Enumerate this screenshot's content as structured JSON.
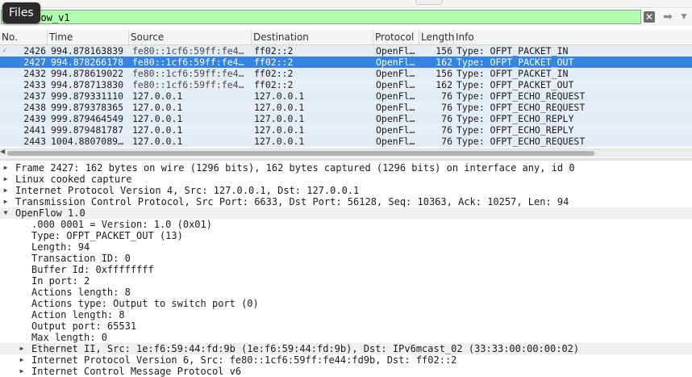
{
  "tooltip": {
    "text": "Files"
  },
  "filter": {
    "value": "flow_v1"
  },
  "columns": [
    "No.",
    "Time",
    "Source",
    "Destination",
    "Protocol",
    "Length",
    "Info"
  ],
  "packets": [
    {
      "no": "2426",
      "time": "994.878163839",
      "src": "fe80::1cf6:59ff:fe4…",
      "dst": "ff02::2",
      "proto": "OpenFl…",
      "len": "156",
      "info": "Type: OFPT_PACKET_IN",
      "selected": false,
      "mark": "✓"
    },
    {
      "no": "2427",
      "time": "994.878266178",
      "src": "fe80::1cf6:59ff:fe4…",
      "dst": "ff02::2",
      "proto": "OpenFl…",
      "len": "162",
      "info": "Type: OFPT_PACKET_OUT",
      "selected": true,
      "mark": ""
    },
    {
      "no": "2432",
      "time": "994.878619022",
      "src": "fe80::1cf6:59ff:fe4…",
      "dst": "ff02::2",
      "proto": "OpenFl…",
      "len": "156",
      "info": "Type: OFPT_PACKET_IN",
      "selected": false,
      "mark": ""
    },
    {
      "no": "2433",
      "time": "994.878713830",
      "src": "fe80::1cf6:59ff:fe4…",
      "dst": "ff02::2",
      "proto": "OpenFl…",
      "len": "162",
      "info": "Type: OFPT_PACKET_OUT",
      "selected": false,
      "mark": ""
    },
    {
      "no": "2437",
      "time": "999.879331110",
      "src": "127.0.0.1",
      "dst": "127.0.0.1",
      "proto": "OpenFl…",
      "len": "76",
      "info": "Type: OFPT_ECHO_REQUEST",
      "selected": false,
      "mark": ""
    },
    {
      "no": "2438",
      "time": "999.879378365",
      "src": "127.0.0.1",
      "dst": "127.0.0.1",
      "proto": "OpenFl…",
      "len": "76",
      "info": "Type: OFPT_ECHO_REQUEST",
      "selected": false,
      "mark": ""
    },
    {
      "no": "2439",
      "time": "999.879464549",
      "src": "127.0.0.1",
      "dst": "127.0.0.1",
      "proto": "OpenFl…",
      "len": "76",
      "info": "Type: OFPT_ECHO_REPLY",
      "selected": false,
      "mark": ""
    },
    {
      "no": "2441",
      "time": "999.879481787",
      "src": "127.0.0.1",
      "dst": "127.0.0.1",
      "proto": "OpenFl…",
      "len": "76",
      "info": "Type: OFPT_ECHO_REPLY",
      "selected": false,
      "mark": ""
    },
    {
      "no": "2443",
      "time": "1004.8807089…",
      "src": "127.0.0.1",
      "dst": "127.0.0.1",
      "proto": "OpenFl…",
      "len": "76",
      "info": "Type: OFPT_ECHO_REQUEST",
      "selected": false,
      "mark": ""
    }
  ],
  "details": [
    {
      "indent": 0,
      "expander": "collapsed",
      "text": "Frame 2427: 162 bytes on wire (1296 bits), 162 bytes captured (1296 bits) on interface any, id 0",
      "highlight": false
    },
    {
      "indent": 0,
      "expander": "collapsed",
      "text": "Linux cooked capture",
      "highlight": false
    },
    {
      "indent": 0,
      "expander": "collapsed",
      "text": "Internet Protocol Version 4, Src: 127.0.0.1, Dst: 127.0.0.1",
      "highlight": false
    },
    {
      "indent": 0,
      "expander": "collapsed",
      "text": "Transmission Control Protocol, Src Port: 6633, Dst Port: 56128, Seq: 10363, Ack: 10257, Len: 94",
      "highlight": false
    },
    {
      "indent": 0,
      "expander": "expanded",
      "text": "OpenFlow 1.0",
      "highlight": true
    },
    {
      "indent": 1,
      "expander": "none",
      "text": ".000 0001 = Version: 1.0 (0x01)",
      "highlight": false
    },
    {
      "indent": 1,
      "expander": "none",
      "text": "Type: OFPT_PACKET_OUT (13)",
      "highlight": false
    },
    {
      "indent": 1,
      "expander": "none",
      "text": "Length: 94",
      "highlight": false
    },
    {
      "indent": 1,
      "expander": "none",
      "text": "Transaction ID: 0",
      "highlight": false
    },
    {
      "indent": 1,
      "expander": "none",
      "text": "Buffer Id: 0xffffffff",
      "highlight": false
    },
    {
      "indent": 1,
      "expander": "none",
      "text": "In port: 2",
      "highlight": false
    },
    {
      "indent": 1,
      "expander": "none",
      "text": "Actions length: 8",
      "highlight": false
    },
    {
      "indent": 1,
      "expander": "none",
      "text": "Actions type: Output to switch port (0)",
      "highlight": false
    },
    {
      "indent": 1,
      "expander": "none",
      "text": "Action length: 8",
      "highlight": false
    },
    {
      "indent": 1,
      "expander": "none",
      "text": "Output port: 65531",
      "highlight": false
    },
    {
      "indent": 1,
      "expander": "none",
      "text": "Max length: 0",
      "highlight": false
    },
    {
      "indent": 1,
      "expander": "collapsed",
      "text": "Ethernet II, Src: 1e:f6:59:44:fd:9b (1e:f6:59:44:fd:9b), Dst: IPv6mcast_02 (33:33:00:00:00:02)",
      "highlight": true
    },
    {
      "indent": 1,
      "expander": "collapsed",
      "text": "Internet Protocol Version 6, Src: fe80::1cf6:59ff:fe44:fd9b, Dst: ff02::2",
      "highlight": false
    },
    {
      "indent": 1,
      "expander": "collapsed",
      "text": "Internet Control Message Protocol v6",
      "highlight": false
    }
  ],
  "colors": {
    "filter_bg": "#afffaf",
    "selection": "#3584e4",
    "row_bg": "#e3ebf4"
  }
}
